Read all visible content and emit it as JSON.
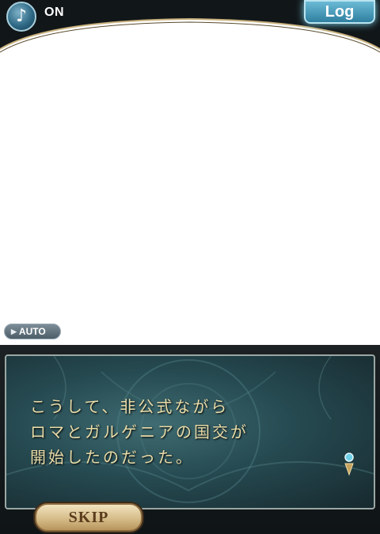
{
  "top_bar": {
    "music_icon": "music-note-icon",
    "music_state": "ON",
    "log_label": "Log"
  },
  "auto_button": {
    "icon": "play-triangle-icon",
    "label": "AUTO"
  },
  "dialog": {
    "lines": [
      "こうして、非公式ながら",
      "ロマとガルゲニアの国交が",
      "開始したのだった。"
    ],
    "next_icon": "next-arrow-icon"
  },
  "skip_button": {
    "label": "SKIP"
  },
  "colors": {
    "accent_blue": "#2f7fa0",
    "dialog_text": "#e9dca8",
    "skip_gold": "#d6bd8a"
  }
}
